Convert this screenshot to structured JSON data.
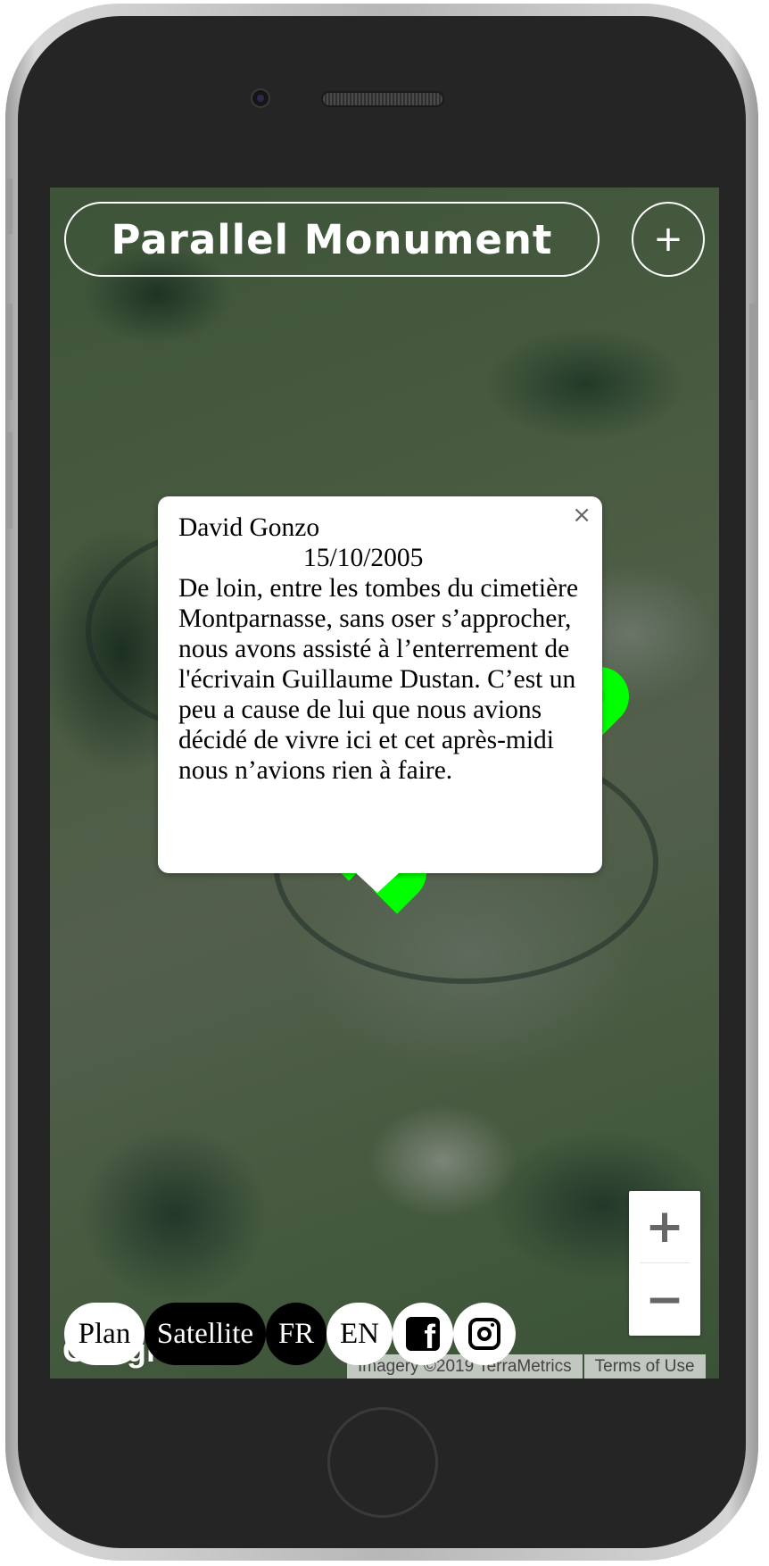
{
  "app": {
    "title": "Parallel Monument",
    "add_label": "+"
  },
  "map": {
    "type": "Satellite",
    "markers": 6
  },
  "info_window": {
    "author": "David Gonzo",
    "date": "15/10/2005",
    "text": "De loin, entre les tombes du cimetière Montparnasse, sans oser s’approcher, nous avons assisté à l’enterrement de l'écrivain Guillaume Dustan. C’est un peu a cause de lui que nous avions décidé de vivre ici et cet après-midi nous n’avions rien à faire.",
    "close_label": "×"
  },
  "zoom": {
    "in_label": "+",
    "out_label": "−"
  },
  "controls": {
    "plan_label": "Plan",
    "satellite_label": "Satellite",
    "fr_label": "FR",
    "en_label": "EN"
  },
  "attribution": {
    "logo": "Google",
    "imagery": "Imagery ©2019 TerraMetrics",
    "terms": "Terms of Use"
  },
  "colors": {
    "marker": "#00ff00"
  },
  "icons": [
    "facebook-icon",
    "instagram-icon",
    "close-icon"
  ]
}
